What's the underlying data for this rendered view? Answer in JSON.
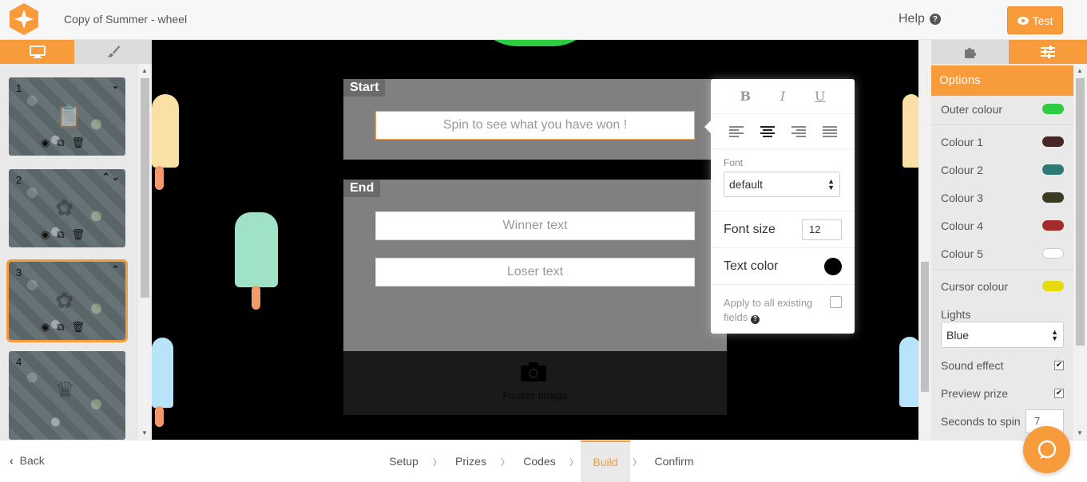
{
  "header": {
    "title": "Copy of Summer - wheel",
    "help_label": "Help",
    "test_label": "Test"
  },
  "left_sidebar": {
    "tabs": [
      {
        "name": "desktop",
        "icon": "monitor-icon",
        "active": true
      },
      {
        "name": "style",
        "icon": "brush-icon",
        "active": false
      }
    ],
    "slides": [
      {
        "number": "1",
        "controls": "⌄",
        "glyph": "📋",
        "selected": false
      },
      {
        "number": "2",
        "controls": "⌃⌄",
        "glyph": "✿",
        "selected": false
      },
      {
        "number": "3",
        "controls": "⌃",
        "glyph": "✿",
        "selected": true
      },
      {
        "number": "4",
        "controls": "",
        "glyph": "♛",
        "selected": false
      }
    ]
  },
  "canvas": {
    "start": {
      "label": "Start",
      "field_placeholder": "Spin to see what you have won !"
    },
    "end": {
      "label": "End",
      "winner_placeholder": "Winner text",
      "loser_placeholder": "Loser text"
    },
    "footer_label": "Footer image",
    "colors": {
      "wheel_edge": "#2ecc40"
    }
  },
  "text_options": {
    "bold": "B",
    "italic": "I",
    "underline": "U",
    "font_label": "Font",
    "font_value": "default",
    "font_size_label": "Font size",
    "font_size_value": "12",
    "text_color_label": "Text color",
    "text_color": "#000000",
    "apply_label": "Apply to all existing fields"
  },
  "right_panel": {
    "tabs": [
      {
        "name": "plugins",
        "icon": "puzzle-icon",
        "active": false
      },
      {
        "name": "options",
        "icon": "sliders-icon",
        "active": true
      }
    ],
    "options_title": "Options",
    "outer_colour": {
      "label": "Outer colour",
      "color": "#2ecc40"
    },
    "colours": [
      {
        "label": "Colour 1",
        "color": "#4a2525"
      },
      {
        "label": "Colour 2",
        "color": "#2e7a73"
      },
      {
        "label": "Colour 3",
        "color": "#3b3a22"
      },
      {
        "label": "Colour 4",
        "color": "#a52a2a"
      },
      {
        "label": "Colour 5",
        "color": "#ffffff"
      }
    ],
    "cursor_colour": {
      "label": "Cursor colour",
      "color": "#e8d90c"
    },
    "lights_label": "Lights",
    "lights_value": "Blue",
    "sound_effect_label": "Sound effect",
    "sound_effect_checked": true,
    "preview_prize_label": "Preview prize",
    "preview_prize_checked": true,
    "seconds_label": "Seconds to spin",
    "seconds_value": "7"
  },
  "bottom_bar": {
    "back_label": "Back",
    "steps": [
      {
        "label": "Setup",
        "active": false
      },
      {
        "label": "Prizes",
        "active": false
      },
      {
        "label": "Codes",
        "active": false
      },
      {
        "label": "Build",
        "active": true
      },
      {
        "label": "Confirm",
        "active": false
      }
    ]
  },
  "accent": "#f89b3b"
}
